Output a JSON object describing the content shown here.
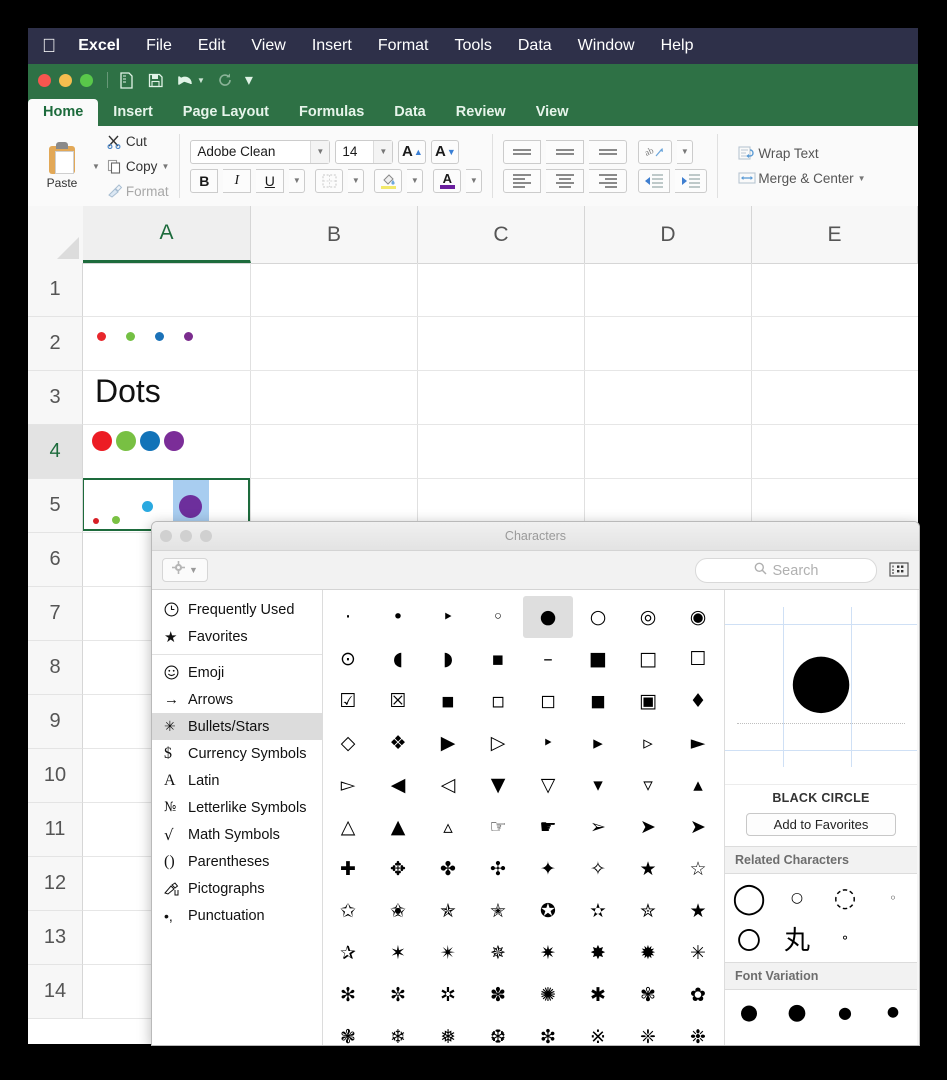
{
  "menubar": {
    "apple_icon": "apple-icon",
    "app": "Excel",
    "items": [
      "File",
      "Edit",
      "View",
      "Insert",
      "Format",
      "Tools",
      "Data",
      "Window",
      "Help"
    ]
  },
  "quickaccess": {
    "items": [
      {
        "name": "new-document-icon",
        "glyph": "὜B"
      },
      {
        "name": "save-icon",
        "glyph": "ὋE"
      },
      {
        "name": "undo-icon",
        "glyph": "↶"
      },
      {
        "name": "redo-icon",
        "glyph": "↻"
      },
      {
        "name": "customize-toolbar-icon",
        "glyph": "▾"
      }
    ]
  },
  "ribbon": {
    "tabs": [
      "Home",
      "Insert",
      "Page Layout",
      "Formulas",
      "Data",
      "Review",
      "View"
    ],
    "active_tab": "Home",
    "clipboard": {
      "paste_label": "Paste",
      "cut_label": "Cut",
      "copy_label": "Copy",
      "format_label": "Format"
    },
    "font": {
      "family_value": "Adobe Clean",
      "size_value": "14",
      "grow_label": "A",
      "shrink_label": "A",
      "bold_label": "B",
      "italic_label": "I",
      "underline_label": "U",
      "borders_label": "borders",
      "fill_label": "A",
      "fontcolor_label": "A",
      "fill_color": "#f2e96b",
      "fontcolor_color": "#6a1f9e"
    },
    "alignment": {
      "wrap_text_label": "Wrap Text",
      "merge_center_label": "Merge & Center",
      "orientation_label": "ab"
    }
  },
  "sheet": {
    "columns": [
      "A",
      "B",
      "C",
      "D",
      "E"
    ],
    "selected_column": "A",
    "rows": [
      "1",
      "2",
      "3",
      "4",
      "5",
      "6",
      "7",
      "8",
      "9",
      "10",
      "11",
      "12",
      "13",
      "14"
    ],
    "selected_row": "4",
    "selected_cell": "A4",
    "cell_A2_text": "Dots",
    "row1_dots": [
      {
        "color": "#e8272c",
        "size": 9
      },
      {
        "color": "#74c044",
        "size": 9
      },
      {
        "color": "#1b72b8",
        "size": 9
      },
      {
        "color": "#7b2d8e",
        "size": 9
      }
    ],
    "row3_dots": [
      {
        "color": "#ec1c24",
        "size": 19
      },
      {
        "color": "#78c043",
        "size": 19
      },
      {
        "color": "#1273b8",
        "size": 19
      },
      {
        "color": "#7b2d98",
        "size": 19
      }
    ],
    "row4_dots": [
      {
        "color": "#d81f26",
        "size": 6
      },
      {
        "color": "#7ac143",
        "size": 8
      },
      {
        "color": "#2aa9e0",
        "size": 11
      },
      {
        "color": "#6d2f9c",
        "size": 22
      }
    ]
  },
  "characters_window": {
    "title": "Characters",
    "search_placeholder": "Search",
    "gear_icon": "gear-icon",
    "keyboard_icon": "keyboard-viewer-icon",
    "categories": [
      {
        "label": "Frequently Used",
        "icon": "clock-icon",
        "glyph": "ὕ0"
      },
      {
        "label": "Favorites",
        "icon": "star-icon",
        "glyph": "★"
      },
      {
        "label": "Emoji",
        "icon": "smiley-icon",
        "glyph": "☺"
      },
      {
        "label": "Arrows",
        "icon": "arrow-right-icon",
        "glyph": "→"
      },
      {
        "label": "Bullets/Stars",
        "icon": "burst-icon",
        "glyph": "✳"
      },
      {
        "label": "Currency Symbols",
        "icon": "dollar-icon",
        "glyph": "$"
      },
      {
        "label": "Latin",
        "icon": "letter-a-icon",
        "glyph": "A"
      },
      {
        "label": "Letterlike Symbols",
        "icon": "numero-icon",
        "glyph": "№"
      },
      {
        "label": "Math Symbols",
        "icon": "radical-icon",
        "glyph": "√"
      },
      {
        "label": "Parentheses",
        "icon": "parentheses-icon",
        "glyph": "()"
      },
      {
        "label": "Pictographs",
        "icon": "pictograph-icon",
        "glyph": "✍"
      },
      {
        "label": "Punctuation",
        "icon": "punctuation-icon",
        "glyph": "•,"
      }
    ],
    "selected_category": "Bullets/Stars",
    "glyphs": [
      "·",
      "•",
      "‣",
      "◦",
      "●",
      "○",
      "◎",
      "◉",
      "⊙",
      "◖",
      "◗",
      "▪",
      "–",
      "■",
      "□",
      "☐",
      "☑",
      "☒",
      "◾",
      "◽",
      "◻",
      "◼",
      "▣",
      "♦",
      "◇",
      "❖",
      "▶",
      "▷",
      "‣",
      "▸",
      "▹",
      "►",
      "▻",
      "◀",
      "◁",
      "▼",
      "▽",
      "▾",
      "▿",
      "▴",
      "△",
      "▲",
      "▵",
      "☞",
      "☛",
      "➢",
      "➤",
      "➤",
      "✚",
      "✥",
      "✤",
      "✣",
      "✦",
      "✧",
      "★",
      "☆",
      "✩",
      "✬",
      "✯",
      "✭",
      "✪",
      "✫",
      "✮",
      "★",
      "✰",
      "✶",
      "✴",
      "✵",
      "✷",
      "✸",
      "✹",
      "✳",
      "✻",
      "✼",
      "✲",
      "✽",
      "✺",
      "✱",
      "✾",
      "✿",
      "❃",
      "❄",
      "❅",
      "❆",
      "❇",
      "※",
      "❈",
      "❉"
    ],
    "selected_glyph_index": 4,
    "detail": {
      "glyph": "●",
      "name": "BLACK CIRCLE",
      "add_favorites_label": "Add to Favorites",
      "related_header": "Related Characters",
      "related": [
        "◯",
        "○",
        "◌",
        "◦",
        "〇",
        "丸",
        "⚬"
      ],
      "font_variation_header": "Font Variation",
      "font_variation": [
        "●",
        "●",
        "●",
        "●"
      ]
    }
  }
}
